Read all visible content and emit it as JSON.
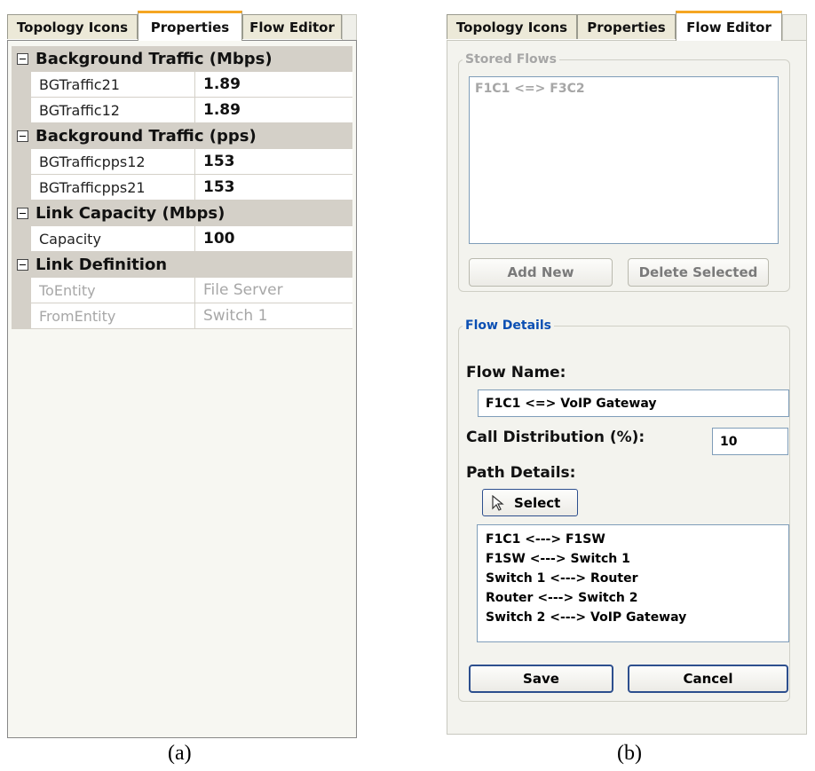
{
  "panel_a": {
    "tabs": [
      "Topology Icons",
      "Properties",
      "Flow Editor"
    ],
    "active_tab": "Properties",
    "groups": [
      {
        "title": "Background Traffic (Mbps)",
        "rows": [
          {
            "name": "BGTraffic21",
            "value": "1.89"
          },
          {
            "name": "BGTraffic12",
            "value": "1.89"
          }
        ]
      },
      {
        "title": "Background Traffic (pps)",
        "rows": [
          {
            "name": "BGTrafficpps12",
            "value": "153"
          },
          {
            "name": "BGTrafficpps21",
            "value": "153"
          }
        ]
      },
      {
        "title": "Link Capacity (Mbps)",
        "rows": [
          {
            "name": "Capacity",
            "value": "100"
          }
        ]
      },
      {
        "title": "Link Definition",
        "rows": [
          {
            "name": "ToEntity",
            "value": "File Server",
            "disabled": true
          },
          {
            "name": "FromEntity",
            "value": "Switch 1",
            "disabled": true
          }
        ]
      }
    ],
    "caption": "(a)"
  },
  "panel_b": {
    "tabs": [
      "Topology Icons",
      "Properties",
      "Flow Editor"
    ],
    "active_tab": "Flow Editor",
    "stored_flows": {
      "legend": "Stored Flows",
      "items": [
        "F1C1 <=> F3C2"
      ],
      "add_label": "Add New",
      "delete_label": "Delete Selected"
    },
    "flow_details": {
      "legend": "Flow Details",
      "flow_name_label": "Flow Name:",
      "flow_name_value": "F1C1 <=> VoIP Gateway",
      "call_dist_label": "Call Distribution (%):",
      "call_dist_value": "10",
      "path_details_label": "Path Details:",
      "select_label": "Select",
      "path_items": [
        "F1C1 <---> F1SW",
        "F1SW <---> Switch 1",
        "Switch 1 <---> Router",
        "Router <---> Switch 2",
        "Switch 2 <---> VoIP Gateway"
      ],
      "save_label": "Save",
      "cancel_label": "Cancel"
    },
    "caption": "(b)"
  },
  "colors": {
    "active_tab_accent": "#f5a623",
    "group_legend_blue": "#0b4fb3",
    "button_border": "#2d4f8e"
  }
}
